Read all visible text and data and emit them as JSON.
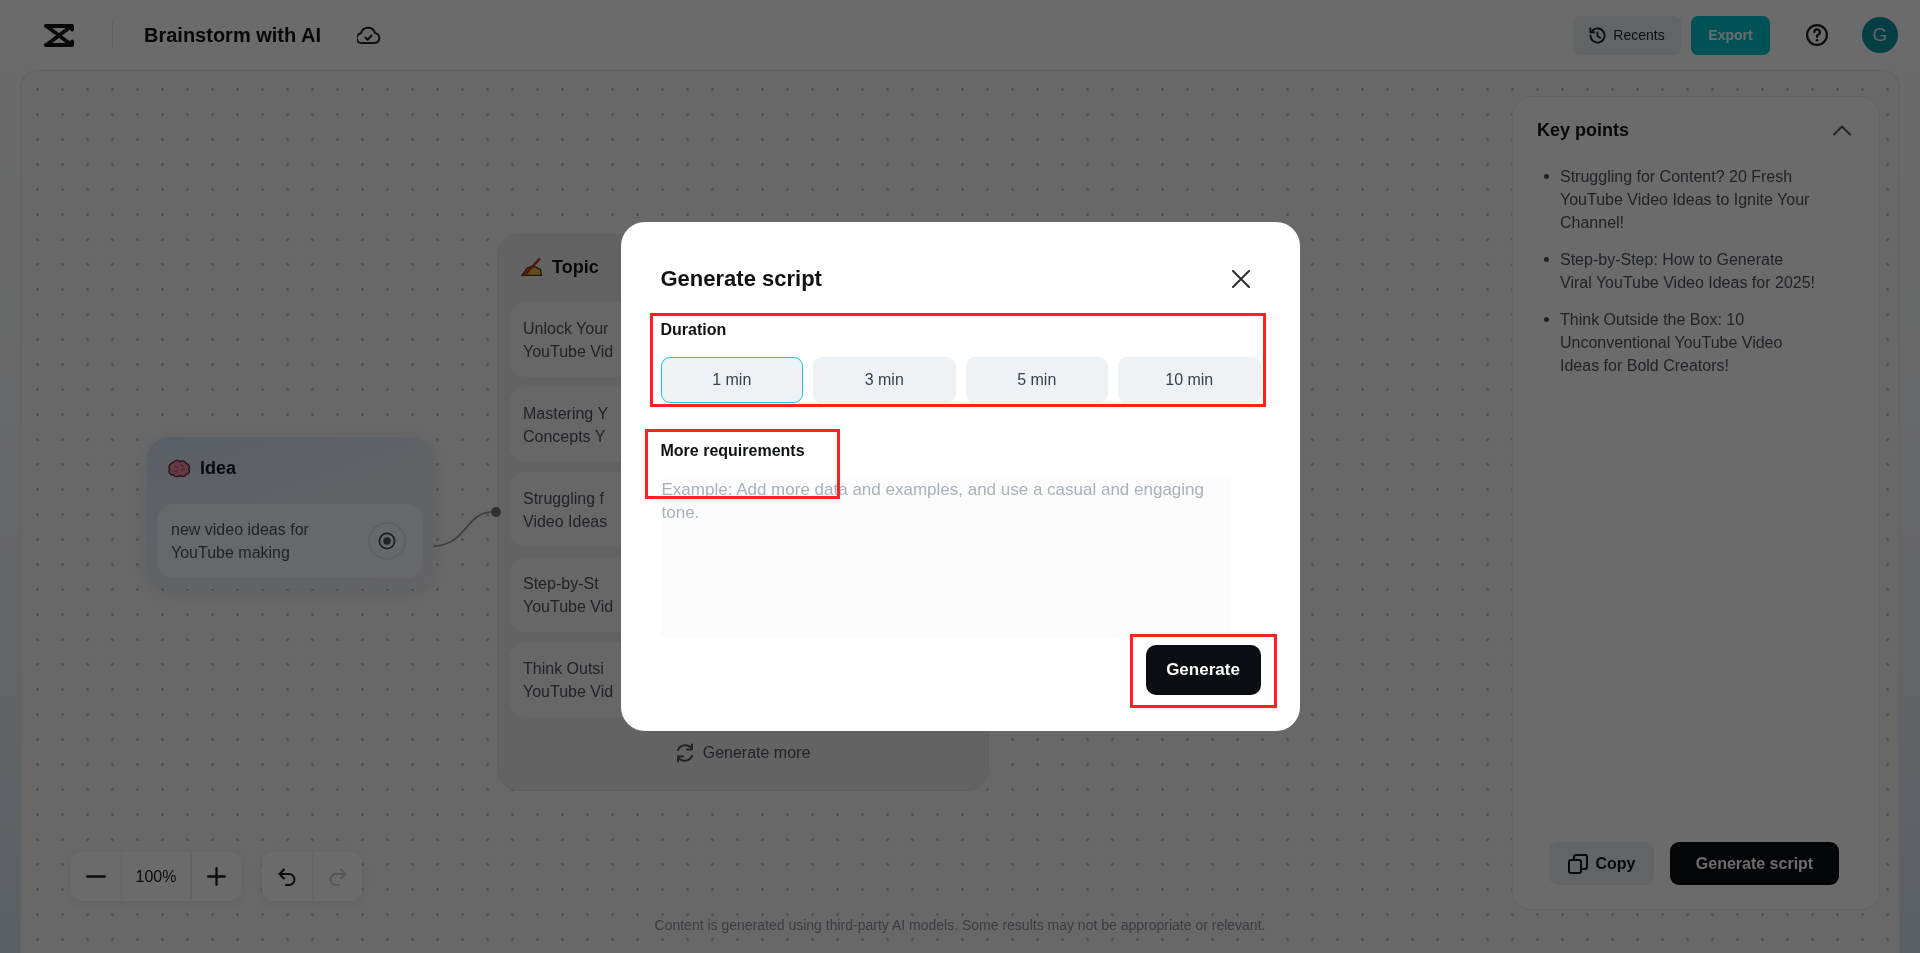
{
  "top_bar": {
    "title": "Brainstorm with AI",
    "recents_button": "Recents",
    "export_button": "Export",
    "avatar_letter": "G"
  },
  "canvas": {
    "idea_node": {
      "title": "Idea",
      "text": "new video ideas for YouTube making"
    },
    "topic_node": {
      "title": "Topic",
      "items": [
        "Unlock Your YouTube Vid",
        "Mastering Y Concepts Y",
        "Struggling f Video Ideas",
        "Step-by-St YouTube Vid",
        "Think Outsi YouTube Vid"
      ],
      "generate_more": "Generate more"
    },
    "zoom_level": "100%",
    "undo": {
      "disabled": false
    },
    "redo": {
      "disabled": true
    },
    "disclaimer": "Content is generated using third-party AI models. Some results may not be appropriate or relevant."
  },
  "key_points": {
    "title": "Key points",
    "expanded": true,
    "items": [
      "Struggling for Content? 20 Fresh YouTube Video Ideas to Ignite Your Channel!",
      "Step-by-Step: How to Generate Viral YouTube Video Ideas for 2025!",
      "Think Outside the Box: 10 Unconventional YouTube Video Ideas for Bold Creators!"
    ],
    "copy_button": "Copy",
    "generate_button": "Generate script"
  },
  "dialog": {
    "title": "Generate script",
    "duration": {
      "label": "Duration",
      "highlighted": true,
      "options": [
        {
          "label": "1 min",
          "selected": true
        },
        {
          "label": "3 min",
          "selected": false
        },
        {
          "label": "5 min",
          "selected": false
        },
        {
          "label": "10 min",
          "selected": false
        }
      ]
    },
    "requirements": {
      "label": "More requirements",
      "placeholder": "Example: Add more data and examples, and use a casual and engaging tone.",
      "highlighted": true
    },
    "generate_button": {
      "label": "Generate",
      "highlighted": true
    }
  }
}
